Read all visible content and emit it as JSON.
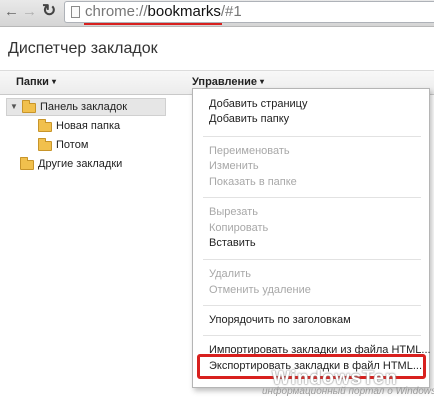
{
  "browser": {
    "back_icon": "back-arrow-icon",
    "forward_icon": "forward-arrow-icon",
    "reload_icon": "reload-icon",
    "url_scheme": "chrome://",
    "url_host": "bookmarks",
    "url_path": "/#1"
  },
  "page": {
    "title": "Диспетчер закладок"
  },
  "header": {
    "folders_label": "Папки",
    "manage_label": "Управление",
    "dropdown_arrow": "▾"
  },
  "tree": {
    "items": [
      {
        "label": "Панель закладок",
        "expanded": true,
        "selected": true
      },
      {
        "label": "Новая папка"
      },
      {
        "label": "Потом"
      },
      {
        "label": "Другие закладки"
      }
    ]
  },
  "menu": {
    "items": [
      {
        "label": "Добавить страницу",
        "enabled": true
      },
      {
        "label": "Добавить папку",
        "enabled": true
      },
      {
        "label": "Переименовать",
        "enabled": false
      },
      {
        "label": "Изменить",
        "enabled": false
      },
      {
        "label": "Показать в папке",
        "enabled": false
      },
      {
        "label": "Вырезать",
        "enabled": false
      },
      {
        "label": "Копировать",
        "enabled": false
      },
      {
        "label": "Вставить",
        "enabled": true
      },
      {
        "label": "Удалить",
        "enabled": false
      },
      {
        "label": "Отменить удаление",
        "enabled": false
      },
      {
        "label": "Упорядочить по заголовкам",
        "enabled": true
      },
      {
        "label": "Импортировать закладки из файла HTML...",
        "enabled": true
      },
      {
        "label": "Экспортировать закладки в файл HTML...",
        "enabled": true,
        "highlighted": true
      }
    ]
  },
  "annotation": {
    "highlight_color": "#d8201e"
  },
  "watermark": {
    "title": "WindowsTen",
    "subtitle": "информационный портал о Windows"
  }
}
